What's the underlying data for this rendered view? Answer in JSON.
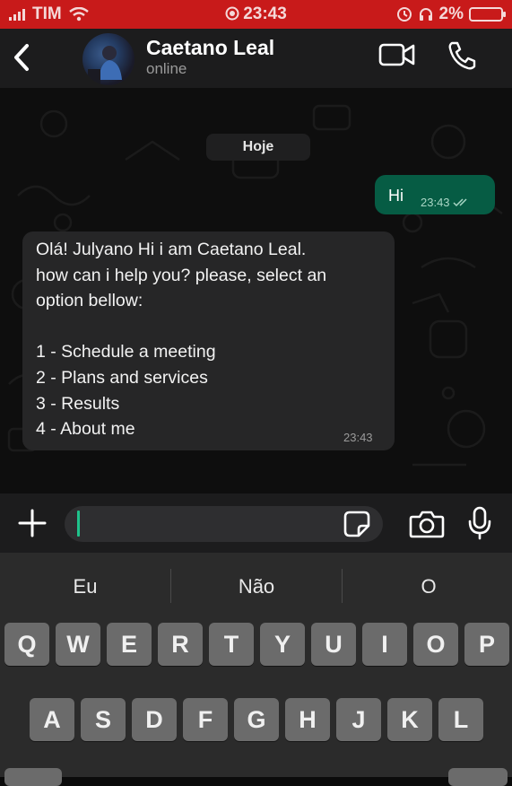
{
  "status_bar": {
    "carrier": "TIM",
    "time": "23:43",
    "battery": "2%"
  },
  "header": {
    "contact_name": "Caetano Leal",
    "contact_status": "online"
  },
  "chat": {
    "date_label": "Hoje",
    "outgoing": {
      "text": "Hi",
      "time": "23:43"
    },
    "incoming": {
      "lines": [
        "Olá! Julyano Hi i am Caetano Leal.",
        "how can i help you? please, select an",
        "option bellow:",
        "",
        "1 - Schedule a meeting",
        "2 - Plans and services",
        "3 - Results",
        "4 - About me"
      ],
      "time": "23:43"
    }
  },
  "composer": {
    "value": ""
  },
  "keyboard": {
    "suggestions": [
      "Eu",
      "Não",
      "O"
    ],
    "row1": [
      "Q",
      "W",
      "E",
      "R",
      "T",
      "Y",
      "U",
      "I",
      "O",
      "P"
    ],
    "row2": [
      "A",
      "S",
      "D",
      "F",
      "G",
      "H",
      "J",
      "K",
      "L"
    ]
  }
}
